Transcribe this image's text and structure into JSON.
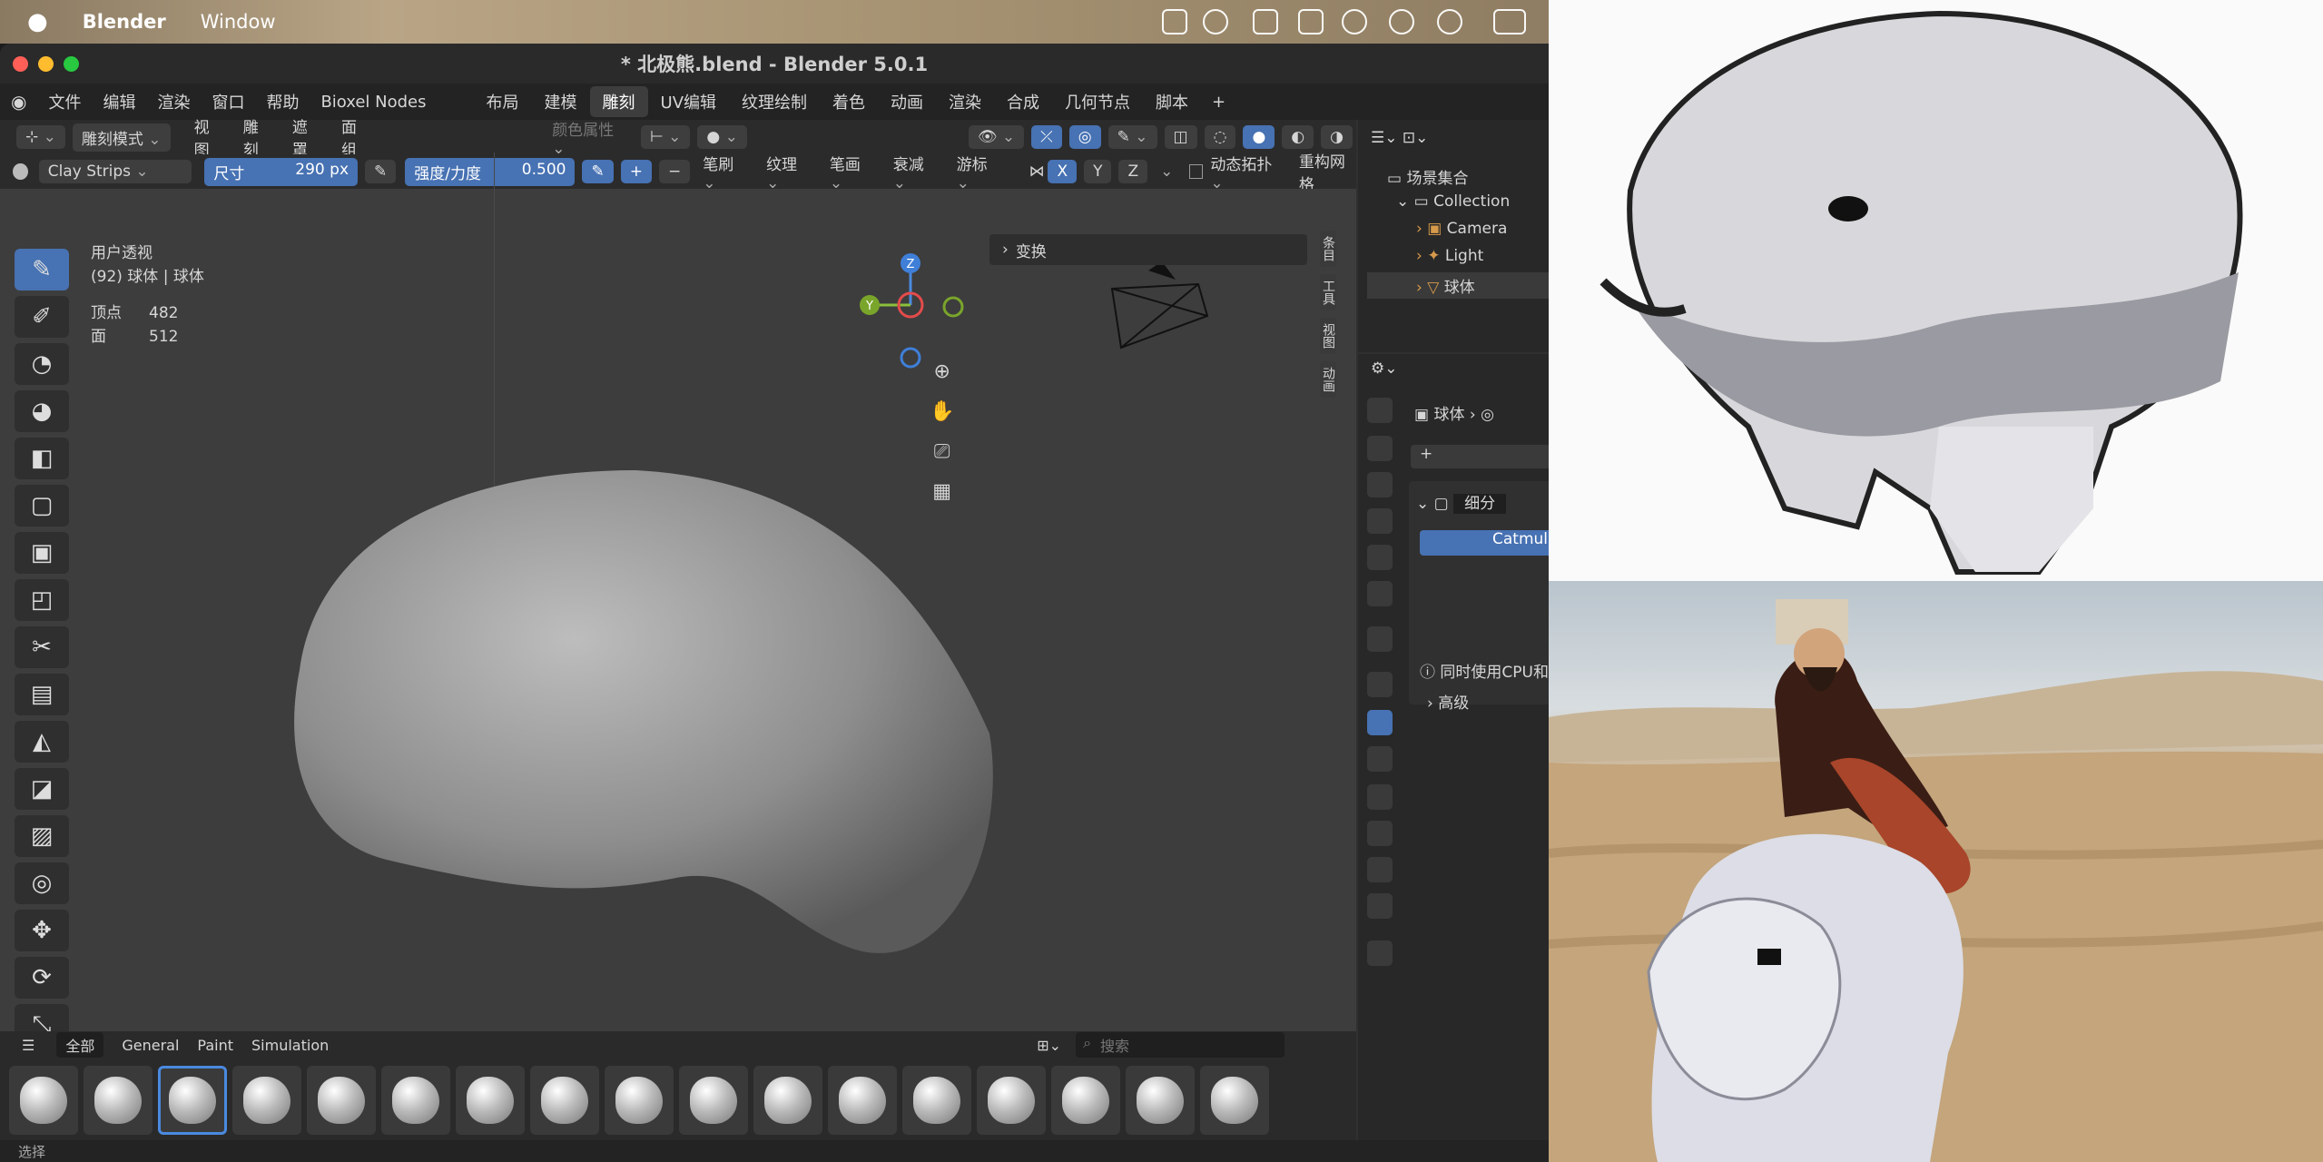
{
  "macbar": {
    "app": "Blender",
    "menu": "Window"
  },
  "window": {
    "title": "* 北极熊.blend - Blender 5.0.1"
  },
  "menu": {
    "items": [
      "文件",
      "编辑",
      "渲染",
      "窗口",
      "帮助",
      "Bioxel Nodes"
    ],
    "workspaces": [
      "布局",
      "建模",
      "雕刻",
      "UV编辑",
      "纹理绘制",
      "着色",
      "动画",
      "渲染",
      "合成",
      "几何节点",
      "脚本"
    ],
    "active_workspace": "雕刻"
  },
  "header": {
    "mode": "雕刻模式",
    "menus": [
      "视图",
      "雕刻",
      "遮罩",
      "面组"
    ],
    "color_attr": "颜色属性",
    "sym_axes": [
      "X",
      "Y",
      "Z"
    ]
  },
  "toolsettings": {
    "brush": "Clay Strips",
    "size_label": "尺寸",
    "size_value": "290 px",
    "strength_label": "强度/力度",
    "strength_value": "0.500",
    "menus": [
      "笔刷",
      "纹理",
      "笔画",
      "衰减",
      "游标"
    ],
    "dyntopo": "动态拓扑",
    "remesh": "重构网格"
  },
  "overlay": {
    "view_name": "用户透视",
    "object_line": "(92) 球体 | 球体",
    "verts_label": "顶点",
    "verts": "482",
    "faces_label": "面",
    "faces": "512"
  },
  "npanel": {
    "transform": "变换",
    "tabs": [
      "条目",
      "工具",
      "视图",
      "动画"
    ]
  },
  "gizmo": {
    "x": "X",
    "y": "Y",
    "z": "Z"
  },
  "brushbar": {
    "tabs": [
      "全部",
      "General",
      "Paint",
      "Simulation"
    ],
    "search_placeholder": "搜索"
  },
  "status": {
    "text": "选择"
  },
  "outliner": {
    "scene_collection": "场景集合",
    "collection": "Collection",
    "items": [
      "Camera",
      "Light",
      "球体"
    ]
  },
  "properties": {
    "object": "球体",
    "modifier": "细分",
    "algorithm": "Catmul",
    "gpu_note": "同时使用CPU和",
    "advanced": "高级"
  }
}
